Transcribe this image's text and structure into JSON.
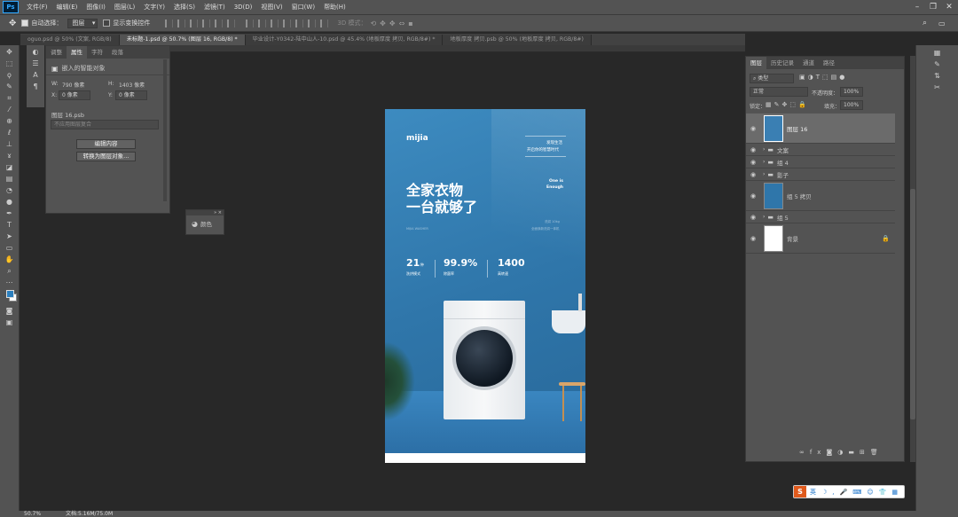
{
  "app": {
    "logo": "Ps"
  },
  "menu": [
    "文件(F)",
    "编辑(E)",
    "图像(I)",
    "图层(L)",
    "文字(Y)",
    "选择(S)",
    "滤镜(T)",
    "3D(D)",
    "视图(V)",
    "窗口(W)",
    "帮助(H)"
  ],
  "options": {
    "auto_select_label": "自动选择：",
    "auto_select_value": "图层",
    "show_transform_label": "显示变换控件",
    "mode_3d": "3D 模式："
  },
  "tabs": [
    "oguo.psd @ 50% (文案, RGB/8)",
    "未标题-1.psd @ 50.7% (图层 16, RGB/8) *",
    "毕业设计-Y0342-陆中山人-10.psd @ 45.4% (地板厚度 拷贝, RGB/8#) *",
    "地板厚度 拷贝.psb @ 50% (地板厚度 拷贝, RGB/8#)"
  ],
  "properties": {
    "tabs": [
      "调整",
      "属性",
      "字符",
      "段落"
    ],
    "title": "嵌入的智能对象",
    "w_label": "W:",
    "w_value": "790 像素",
    "h_label": "H:",
    "h_value": "1403 像素",
    "x_label": "X:",
    "x_value": "0 像素",
    "y_label": "Y:",
    "y_value": "0 像素",
    "file": "图层 16.psb",
    "comp_placeholder": "不应用图层复合",
    "edit_btn": "编辑内容",
    "convert_btn": "转换为图层对象..."
  },
  "color_panel": {
    "label": "颜色"
  },
  "poster": {
    "brand": "mijia",
    "tagline1": "发现生活",
    "tagline2": "开启你的智慧时代",
    "headline1": "全家衣物",
    "headline2": "一台就够了",
    "one_is_1": "One is",
    "one_is_2": "Enough",
    "sub_left": "MIJIA WASHER",
    "sub_right1": "洗烘 10kg",
    "sub_right2": "全面焕新洗烘一体机",
    "stat1_value": "21",
    "stat1_unit": "种",
    "stat1_label": "洗烘模式",
    "stat2_value": "99.9%",
    "stat2_label": "除菌率",
    "stat3_value": "1400",
    "stat3_label": "高转速"
  },
  "layers": {
    "tabs": [
      "图层",
      "历史记录",
      "通道",
      "路径"
    ],
    "filter": "类型",
    "blend": "正常",
    "opacity_label": "不透明度：",
    "opacity": "100%",
    "lock_label": "锁定：",
    "fill_label": "填充：",
    "fill": "100%",
    "items": [
      {
        "name": "图层 16"
      },
      {
        "name": "文案"
      },
      {
        "name": "组 4"
      },
      {
        "name": "影子"
      },
      {
        "name": "组 5 拷贝"
      },
      {
        "name": "组 5"
      },
      {
        "name": "背景"
      }
    ]
  },
  "status": {
    "zoom": "50.7%",
    "doc": "文档:5.16M/75.0M"
  },
  "ime": {
    "label": "英"
  }
}
